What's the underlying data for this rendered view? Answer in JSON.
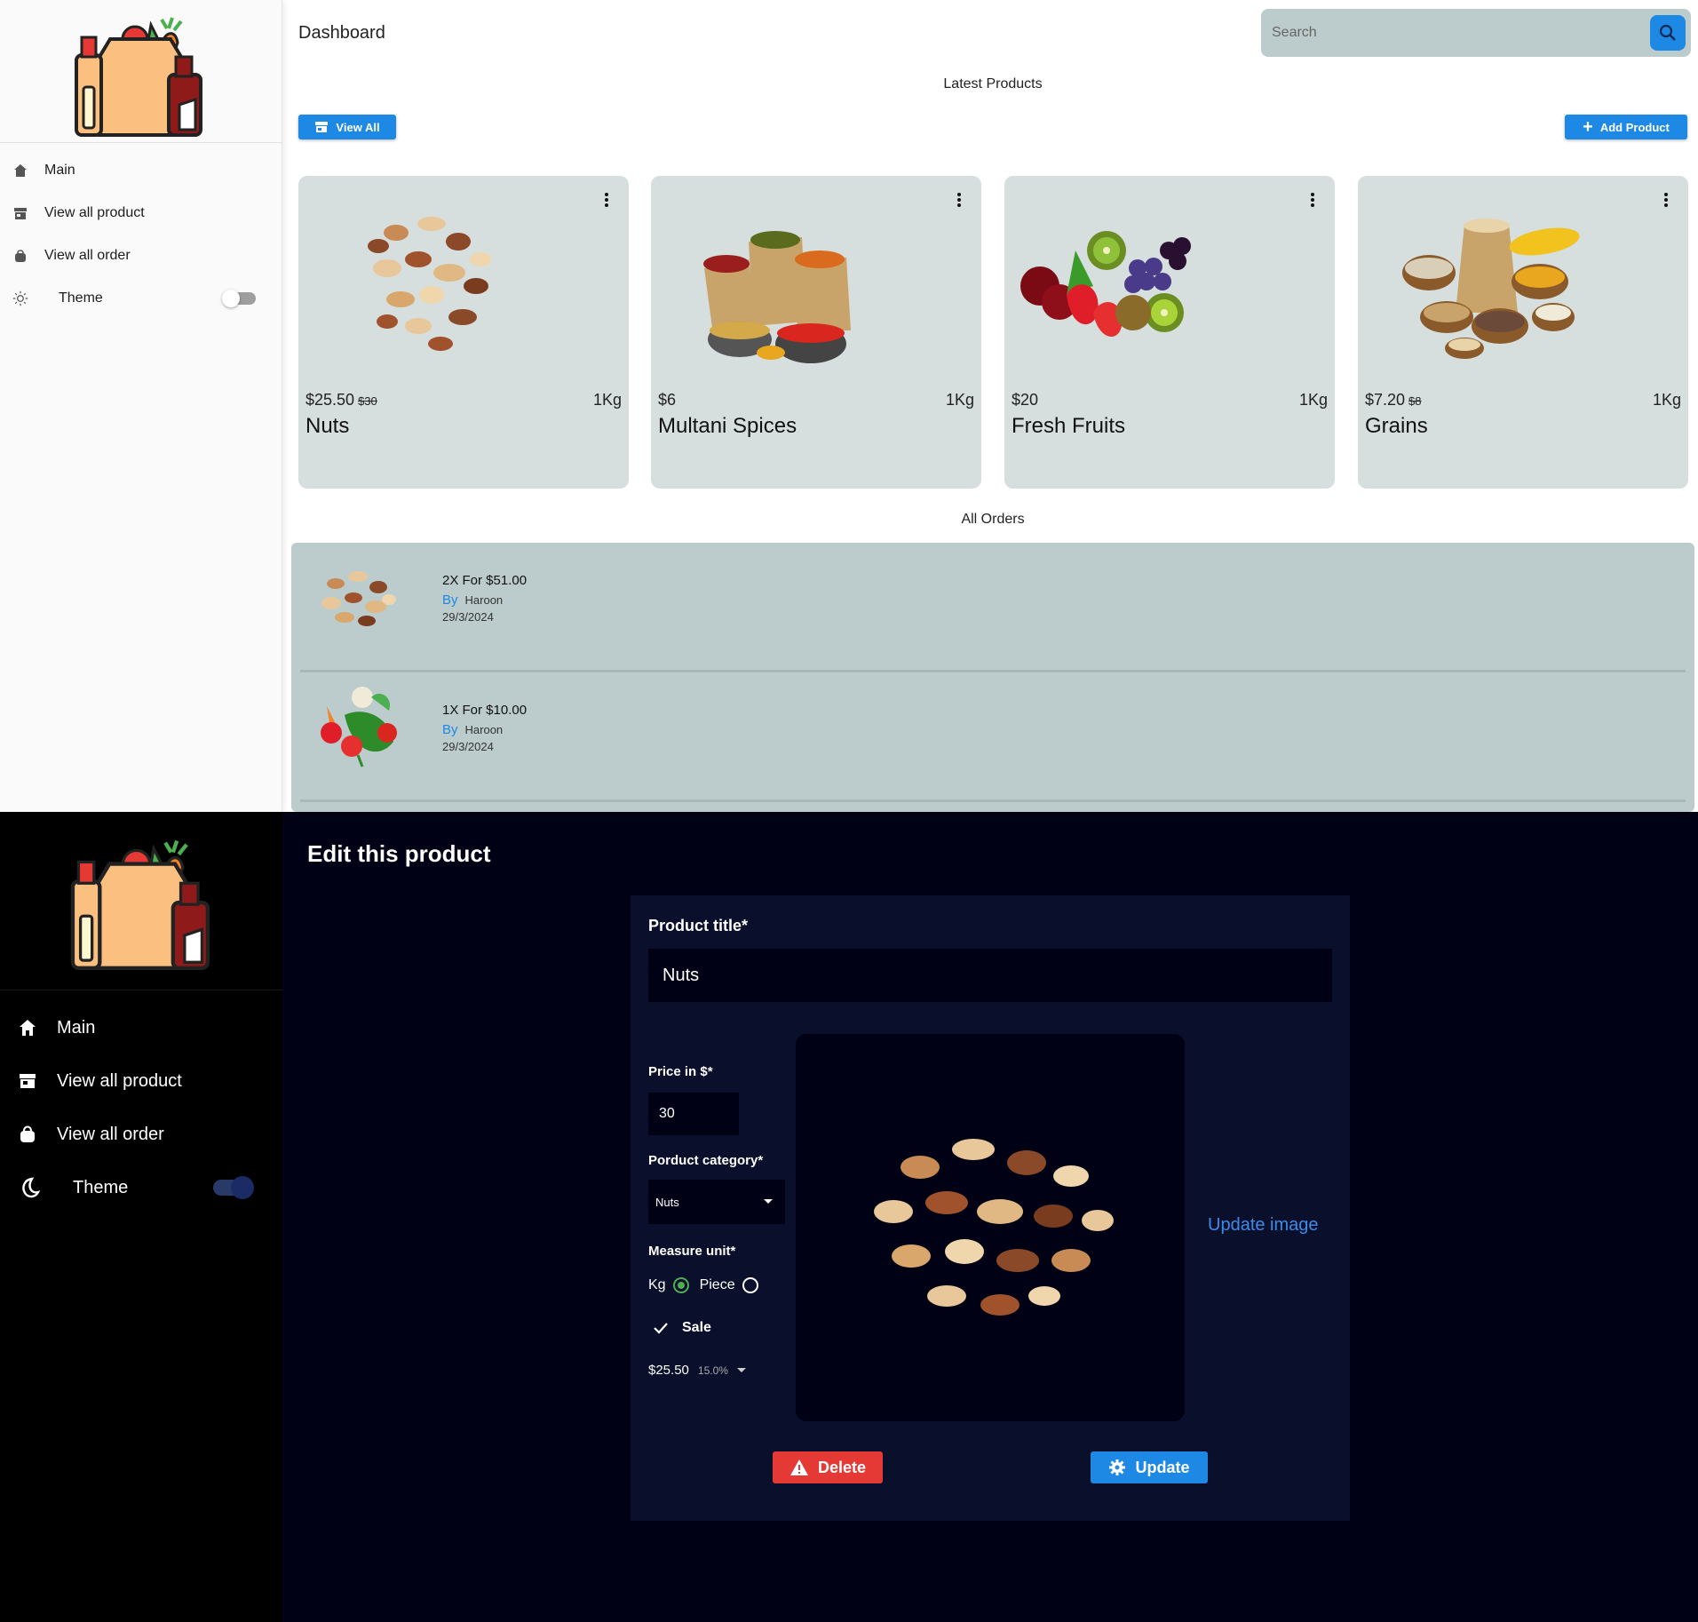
{
  "light": {
    "sidebar": {
      "logo": "grocery-bag-logo",
      "items": [
        {
          "label": "Main",
          "icon": "home-icon"
        },
        {
          "label": "View all product",
          "icon": "store-icon"
        },
        {
          "label": "View all order",
          "icon": "shopping-bag-icon"
        },
        {
          "label": "Theme",
          "icon": "sun-icon"
        }
      ],
      "theme_toggle_on": false
    },
    "header": {
      "title": "Dashboard",
      "search_placeholder": "Search"
    },
    "latest_products": {
      "title": "Latest Products",
      "view_all_label": "View All",
      "add_product_label": "Add Product",
      "products": [
        {
          "price": "$25.50",
          "old_price": "$30",
          "unit": "1Kg",
          "name": "Nuts",
          "image": "nuts"
        },
        {
          "price": "$6",
          "old_price": "",
          "unit": "1Kg",
          "name": "Multani Spices",
          "image": "spices"
        },
        {
          "price": "$20",
          "old_price": "",
          "unit": "1Kg",
          "name": "Fresh Fruits",
          "image": "fruits"
        },
        {
          "price": "$7.20",
          "old_price": "$8",
          "unit": "1Kg",
          "name": "Grains",
          "image": "grains"
        }
      ]
    },
    "orders": {
      "title": "All Orders",
      "items": [
        {
          "summary": "2X For $51.00",
          "by_label": "By",
          "customer": "Haroon",
          "date": "29/3/2024",
          "image": "nuts"
        },
        {
          "summary": "1X For $10.00",
          "by_label": "By",
          "customer": "Haroon",
          "date": "29/3/2024",
          "image": "vegetables"
        }
      ]
    }
  },
  "dark": {
    "sidebar": {
      "logo": "grocery-bag-logo",
      "items": [
        {
          "label": "Main",
          "icon": "home-icon"
        },
        {
          "label": "View all product",
          "icon": "store-icon"
        },
        {
          "label": "View all order",
          "icon": "shopping-bag-icon"
        },
        {
          "label": "Theme",
          "icon": "moon-icon"
        }
      ],
      "theme_toggle_on": true
    },
    "edit": {
      "page_title": "Edit this product",
      "title_label": "Product title*",
      "title_value": "Nuts",
      "price_label": "Price in $*",
      "price_value": "30",
      "category_label": "Porduct category*",
      "category_value": "Nuts",
      "measure_label": "Measure unit*",
      "measure_options": [
        "Kg",
        "Piece"
      ],
      "measure_selected": "Kg",
      "sale_label": "Sale",
      "sale_checked": true,
      "sale_price": "$25.50",
      "sale_percent": "15.0%",
      "update_image_label": "Update image",
      "delete_label": "Delete",
      "update_label": "Update"
    }
  },
  "colors": {
    "accent": "#1e88e5",
    "danger": "#e53935",
    "card_bg": "#d6dede",
    "orders_bg": "#bccbcb",
    "dark_bg": "#000114",
    "dark_panel": "#0a0f2c"
  }
}
